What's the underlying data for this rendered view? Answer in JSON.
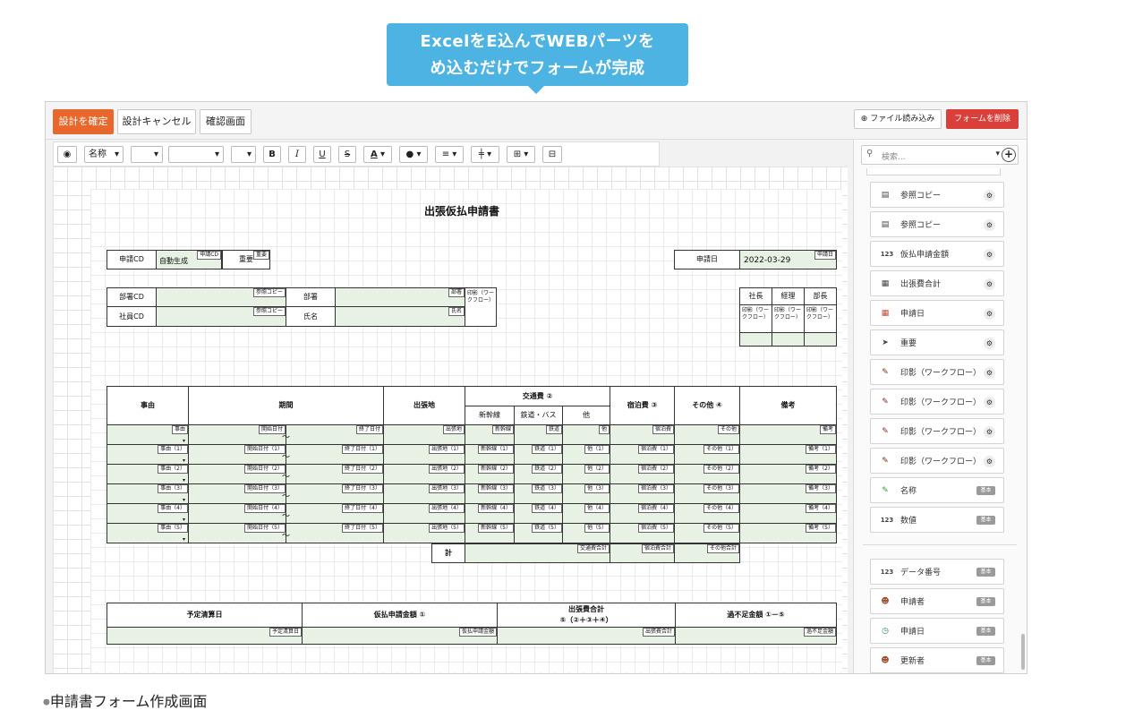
{
  "callout": {
    "line1": "ExcelをE込んでWEBパーツを",
    "line2": "め込むだけでフォームが完成"
  },
  "toolbar": {
    "confirm": "設計を確定",
    "cancel": "設計キャンセル",
    "preview": "確認画面",
    "import": "ファイル読み込み",
    "delete": "フォームを削除",
    "accent": "#e8672a",
    "danger": "#d9403a"
  },
  "format": {
    "style_select": "名称",
    "bold": "B",
    "italic": "I",
    "underline": "U",
    "strike": "S",
    "font_color": "A"
  },
  "form": {
    "title": "出張仮払申請書",
    "app_cd_label": "申請CD",
    "app_cd_value": "自動生成",
    "app_cd_tag": "申請CD",
    "important_label": "重要",
    "important_tag": "重要",
    "app_date_label": "申請日",
    "app_date_value": "2022-03-29",
    "app_date_tag": "申請日",
    "dept_cd_label": "部署CD",
    "emp_cd_label": "社員CD",
    "ref_copy_tag": "参照コピー",
    "dept_label": "部署",
    "dept_tag": "部署",
    "name_label": "氏名",
    "name_tag": "氏名",
    "seal_text": "印影（ワークフロー）",
    "approvers": [
      "社長",
      "経理",
      "部長"
    ],
    "table_headers": {
      "reason": "事由",
      "period": "期間",
      "destination": "出張地",
      "transport": "交通費 ②",
      "shinkansen": "新幹線",
      "rail_bus": "鉄道・バス",
      "other_t": "他",
      "lodging": "宿泊費 ③",
      "other": "その他 ④",
      "remarks": "備考"
    },
    "row_tags": [
      {
        "reason": "事由",
        "start": "開始日付",
        "end": "終了日付",
        "dest": "出張地",
        "shin": "新幹線",
        "rail": "鉄道",
        "oth": "他",
        "lodg": "宿泊費",
        "other": "その他",
        "rem": "備考"
      },
      {
        "reason": "事由（1）",
        "start": "開始日付（1）",
        "end": "終了日付（1）",
        "dest": "出張地（1）",
        "shin": "新幹線（1）",
        "rail": "鉄道（1）",
        "oth": "他（1）",
        "lodg": "宿泊費（1）",
        "other": "その他（1）",
        "rem": "備考（1）"
      },
      {
        "reason": "事由（2）",
        "start": "開始日付（2）",
        "end": "終了日付（2）",
        "dest": "出張地（2）",
        "shin": "新幹線（2）",
        "rail": "鉄道（2）",
        "oth": "他（2）",
        "lodg": "宿泊費（2）",
        "other": "その他（2）",
        "rem": "備考（2）"
      },
      {
        "reason": "事由（3）",
        "start": "開始日付（3）",
        "end": "終了日付（3）",
        "dest": "出張地（3）",
        "shin": "新幹線（3）",
        "rail": "鉄道（3）",
        "oth": "他（3）",
        "lodg": "宿泊費（3）",
        "other": "その他（3）",
        "rem": "備考（3）"
      },
      {
        "reason": "事由（4）",
        "start": "開始日付（4）",
        "end": "終了日付（4）",
        "dest": "出張地（4）",
        "shin": "新幹線（4）",
        "rail": "鉄道（4）",
        "oth": "他（4）",
        "lodg": "宿泊費（4）",
        "other": "その他（4）",
        "rem": "備考（4）"
      },
      {
        "reason": "事由（5）",
        "start": "開始日付（5）",
        "end": "終了日付（5）",
        "dest": "出張地（5）",
        "shin": "新幹線（5）",
        "rail": "鉄道（5）",
        "oth": "他（5）",
        "lodg": "宿泊費（5）",
        "other": "その他（5）",
        "rem": "備考（5）"
      }
    ],
    "tilde": "～",
    "total_label": "計",
    "transport_total_tag": "交通費合計",
    "lodging_total_tag": "宿泊費合計",
    "other_total_tag": "その他合計",
    "summary": {
      "settle_date": "予定清算日",
      "settle_date_tag": "予定清算日",
      "advance": "仮払申請金額 ①",
      "advance_tag": "仮払申請金額",
      "trip_total": "出張費合計",
      "trip_total_formula": "⑤（②＋③＋④）",
      "trip_total_tag": "出張費合計",
      "diff": "過不足金額 ①－⑤",
      "diff_tag": "過不足金額"
    }
  },
  "panel": {
    "search_placeholder": "検索...",
    "parts": [
      {
        "label": "参照コピー",
        "icon": "doc-icon"
      },
      {
        "label": "参照コピー",
        "icon": "doc-icon"
      },
      {
        "label": "仮払申請金額",
        "icon": "number-icon"
      },
      {
        "label": "出張費合計",
        "icon": "calc-icon"
      },
      {
        "label": "申請日",
        "icon": "calendar-icon"
      },
      {
        "label": "重要",
        "icon": "pointer-icon"
      },
      {
        "label": "印影（ワークフロー）",
        "icon": "seal-icon"
      },
      {
        "label": "印影（ワークフロー）",
        "icon": "seal-icon"
      },
      {
        "label": "印影（ワークフロー）",
        "icon": "seal-icon"
      },
      {
        "label": "印影（ワークフロー）",
        "icon": "seal-icon"
      },
      {
        "label": "名称",
        "icon": "pencil-icon",
        "badge": "基本"
      },
      {
        "label": "数値",
        "icon": "number-icon",
        "badge": "基本"
      }
    ],
    "system_parts": [
      {
        "label": "データ番号",
        "icon": "number-icon",
        "badge": "基本"
      },
      {
        "label": "申請者",
        "icon": "person-icon",
        "badge": "基本"
      },
      {
        "label": "申請日",
        "icon": "clock-icon",
        "badge": "基本"
      },
      {
        "label": "更新者",
        "icon": "person-icon",
        "badge": "基本"
      }
    ]
  },
  "caption": "申請書フォーム作成画面"
}
